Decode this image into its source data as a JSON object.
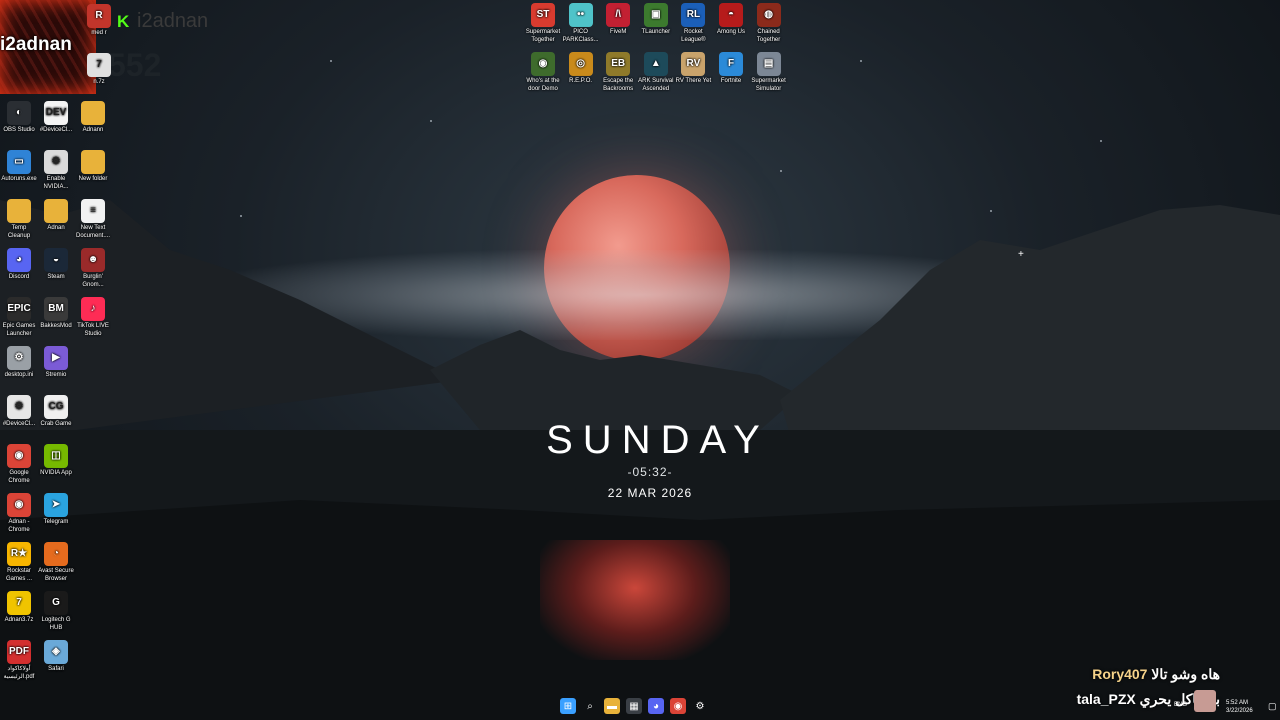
{
  "stream": {
    "streamer_name": "i2adnan",
    "kick_name": "i2adnan",
    "viewer_count": "552",
    "kick_logo": "K"
  },
  "top_icons": [
    {
      "label": "Supermarket Together",
      "icon": "supermarket-together-icon",
      "glyph": "ST",
      "color": "#d83b2f"
    },
    {
      "label": "PICO PARKClass...",
      "icon": "pico-park-icon",
      "glyph": "••",
      "color": "#4fc3c9"
    },
    {
      "label": "FiveM",
      "icon": "fivem-icon",
      "glyph": "/\\",
      "color": "#c22032"
    },
    {
      "label": "TLauncher",
      "icon": "tlauncher-icon",
      "glyph": "▣",
      "color": "#3c7a2e"
    },
    {
      "label": "Rocket League®",
      "icon": "rocket-league-icon",
      "glyph": "RL",
      "color": "#1b5fb8"
    },
    {
      "label": "Among Us",
      "icon": "among-us-icon",
      "glyph": "◓",
      "color": "#b61b1b"
    },
    {
      "label": "Chained Together",
      "icon": "chained-together-icon",
      "glyph": "◍",
      "color": "#8b2a1b"
    },
    {
      "label": "Who's at the door Demo",
      "icon": "whos-at-the-door-icon",
      "glyph": "◉",
      "color": "#3e6b2c"
    },
    {
      "label": "R.E.P.O.",
      "icon": "repo-icon",
      "glyph": "◎",
      "color": "#c98a1b"
    },
    {
      "label": "Escape the Backrooms",
      "icon": "escape-backrooms-icon",
      "glyph": "EB",
      "color": "#8f7a2a"
    },
    {
      "label": "ARK Survival Ascended",
      "icon": "ark-icon",
      "glyph": "▲",
      "color": "#1d4a5a"
    },
    {
      "label": "RV There Yet",
      "icon": "rv-there-yet-icon",
      "glyph": "RV",
      "color": "#c9a36b"
    },
    {
      "label": "Fortnite",
      "icon": "fortnite-icon",
      "glyph": "F",
      "color": "#2b8ad8"
    },
    {
      "label": "Supermarket Simulator",
      "icon": "supermarket-simulator-icon",
      "glyph": "▤",
      "color": "#7c8795"
    }
  ],
  "left_icons": [
    {
      "label": "OBS Studio",
      "icon": "obs-studio-icon",
      "glyph": "◐",
      "color": "#2a2e33"
    },
    {
      "label": "#DeviceCl...",
      "icon": "device-cleanup-icon",
      "glyph": "DEV",
      "color": "#f4f4f4"
    },
    {
      "label": "Adnann",
      "icon": "folder-icon",
      "glyph": "",
      "color": "#e8b23a"
    },
    {
      "label": "Autoruns.exe",
      "icon": "autoruns-icon",
      "glyph": "▭",
      "color": "#2f83d6"
    },
    {
      "label": "Enable NVIDIA...",
      "icon": "settings-file-icon",
      "glyph": "⚙",
      "color": "#dadada"
    },
    {
      "label": "New folder",
      "icon": "folder-icon",
      "glyph": "",
      "color": "#e8b23a"
    },
    {
      "label": "Temp Cleanup",
      "icon": "folder-icon",
      "glyph": "",
      "color": "#e8b23a"
    },
    {
      "label": "Adnan",
      "icon": "folder-icon",
      "glyph": "",
      "color": "#e8b23a"
    },
    {
      "label": "New Text Document....",
      "icon": "text-document-icon",
      "glyph": "≡",
      "color": "#f2f2f2"
    },
    {
      "label": "Discord",
      "icon": "discord-icon",
      "glyph": "◕",
      "color": "#5865f2"
    },
    {
      "label": "Steam",
      "icon": "steam-icon",
      "glyph": "◒",
      "color": "#1b2838"
    },
    {
      "label": "Burglin' Gnom...",
      "icon": "burglin-gnomes-icon",
      "glyph": "☻",
      "color": "#9a2a2a"
    },
    {
      "label": "Epic Games Launcher",
      "icon": "epic-games-icon",
      "glyph": "EPIC",
      "color": "#2b2b2b"
    },
    {
      "label": "BakkesMod",
      "icon": "bakkesmod-icon",
      "glyph": "BM",
      "color": "#3a3a3a"
    },
    {
      "label": "TikTok LIVE Studio",
      "icon": "tiktok-live-icon",
      "glyph": "♪",
      "color": "#fe2c55"
    },
    {
      "label": "desktop.ini",
      "icon": "ini-file-icon",
      "glyph": "⚙",
      "color": "#9aa0a6"
    },
    {
      "label": "Stremio",
      "icon": "stremio-icon",
      "glyph": "▶",
      "color": "#7b5bd6"
    },
    {
      "label": "#DeviceCl...",
      "icon": "file-icon",
      "glyph": "⚙",
      "color": "#e6e6e6"
    },
    {
      "label": "Crab Game",
      "icon": "crab-game-icon",
      "glyph": "CG",
      "color": "#f0f0f0"
    },
    {
      "label": "Google Chrome",
      "icon": "chrome-icon",
      "glyph": "◉",
      "color": "#db4437"
    },
    {
      "label": "NVIDIA App",
      "icon": "nvidia-icon",
      "glyph": "◫",
      "color": "#76b900"
    },
    {
      "label": "Adnan - Chrome",
      "icon": "chrome-icon",
      "glyph": "◉",
      "color": "#db4437"
    },
    {
      "label": "Telegram",
      "icon": "telegram-icon",
      "glyph": "➤",
      "color": "#2aa3df"
    },
    {
      "label": "Rockstar Games ...",
      "icon": "rockstar-icon",
      "glyph": "R★",
      "color": "#f7b500"
    },
    {
      "label": "Avast Secure Browser",
      "icon": "avast-browser-icon",
      "glyph": "◔",
      "color": "#e56b1e"
    },
    {
      "label": "Adnan3.7z",
      "icon": "archive-icon",
      "glyph": "7",
      "color": "#f0c400"
    },
    {
      "label": "Logitech G HUB",
      "icon": "logitech-ghub-icon",
      "glyph": "G",
      "color": "#1a1a1a"
    },
    {
      "label": "أولاكاكواد الرئيسية.pdf",
      "icon": "pdf-icon",
      "glyph": "PDF",
      "color": "#d32f2f"
    },
    {
      "label": "Safari",
      "icon": "safari-icon",
      "glyph": "◈",
      "color": "#6aa9d8"
    }
  ],
  "partial_icons": [
    {
      "label": "med r",
      "icon": "partial-icon",
      "glyph": "R",
      "color": "#c2352b"
    },
    {
      "label": "n.7z",
      "icon": "archive-icon",
      "glyph": "7",
      "color": "#e0e0e0"
    }
  ],
  "clock": {
    "day": "SUNDAY",
    "time": "-05:32-",
    "date": "22 MAR 2026"
  },
  "chat": [
    {
      "user": "Rory407",
      "message": "هاه وشو تالا"
    },
    {
      "user": "tala_PZX",
      "message": "بي باكل يحري"
    }
  ],
  "taskbar": [
    {
      "name": "start-button",
      "icon": "windows-icon",
      "glyph": "⊞",
      "color": "#3aa0ff"
    },
    {
      "name": "search-button",
      "icon": "search-icon",
      "glyph": "⌕",
      "color": "transparent"
    },
    {
      "name": "file-explorer-button",
      "icon": "folder-icon",
      "glyph": "▬",
      "color": "#e8b23a"
    },
    {
      "name": "calendar-button",
      "icon": "calendar-icon",
      "glyph": "▦",
      "color": "#3a3f45"
    },
    {
      "name": "discord-taskbar-button",
      "icon": "discord-icon",
      "glyph": "◕",
      "color": "#5865f2"
    },
    {
      "name": "chrome-taskbar-button",
      "icon": "chrome-icon",
      "glyph": "◉",
      "color": "#db4437"
    },
    {
      "name": "settings-taskbar-button",
      "icon": "gear-icon",
      "glyph": "⚙",
      "color": "transparent"
    }
  ],
  "tray": {
    "language": "ENG",
    "time": "5:52 AM",
    "date": "3/22/2026"
  }
}
